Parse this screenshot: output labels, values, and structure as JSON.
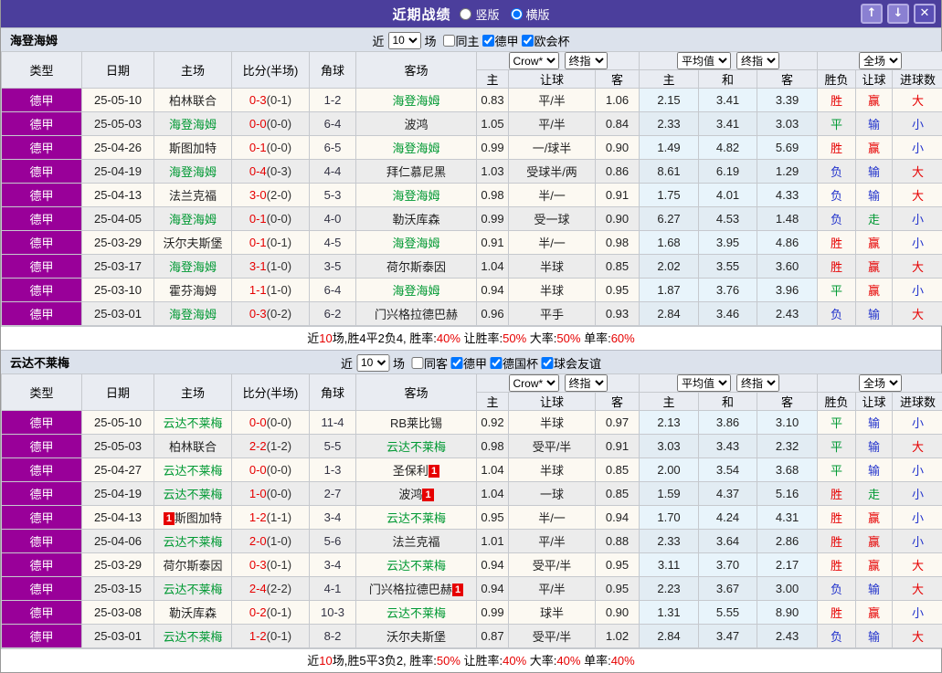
{
  "titlebar": {
    "title": "近期战绩",
    "view_options": [
      {
        "label": "竖版",
        "selected": false
      },
      {
        "label": "横版",
        "selected": true
      }
    ],
    "buttons": {
      "up_glyph": "↑",
      "down_glyph": "↓",
      "close_glyph": "✕"
    }
  },
  "table_header": {
    "cols": {
      "type": "类型",
      "date": "日期",
      "home": "主场",
      "score": "比分(半场)",
      "corner": "角球",
      "away": "客场"
    },
    "selects": {
      "bookmaker": "Crow*",
      "final1": "终指",
      "average": "平均值",
      "final2": "终指",
      "scope": "全场"
    },
    "sub": {
      "odds_home": "主",
      "odds_handicap": "让球",
      "odds_away": "客",
      "avg_home": "主",
      "avg_draw": "和",
      "avg_away": "客",
      "res_outcome": "胜负",
      "res_handicap": "让球",
      "res_goals": "进球数"
    }
  },
  "result_colors": {
    "胜": "red",
    "平": "green",
    "负": "blue",
    "赢": "red",
    "输": "blue",
    "走": "green",
    "大": "red",
    "小": "blue"
  },
  "colors": {
    "accent_purple": "#4b3e9c",
    "league_magenta": "#990099",
    "team_green": "#009933",
    "loss_blue": "#2233cc",
    "win_red": "#e60000"
  },
  "sections": [
    {
      "name": "海登海姆",
      "recent_prefix": "近",
      "games": "10",
      "recent_suffix": "场",
      "filters": [
        {
          "label": "同主",
          "checked": false
        },
        {
          "label": "德甲",
          "checked": true
        },
        {
          "label": "欧会杯",
          "checked": true
        }
      ],
      "rows": [
        {
          "league": "德甲",
          "date": "25-05-10",
          "home": {
            "name": "柏林联合"
          },
          "score": "0-3",
          "half": "(0-1)",
          "corner": "1-2",
          "away": {
            "name": "海登海姆",
            "team": true
          },
          "odds": [
            "0.83",
            "平/半",
            "1.06"
          ],
          "avg": [
            "2.15",
            "3.41",
            "3.39"
          ],
          "res": [
            "胜",
            "赢",
            "大"
          ]
        },
        {
          "league": "德甲",
          "date": "25-05-03",
          "home": {
            "name": "海登海姆",
            "team": true
          },
          "score": "0-0",
          "half": "(0-0)",
          "corner": "6-4",
          "away": {
            "name": "波鸿"
          },
          "odds": [
            "1.05",
            "平/半",
            "0.84"
          ],
          "avg": [
            "2.33",
            "3.41",
            "3.03"
          ],
          "res": [
            "平",
            "输",
            "小"
          ]
        },
        {
          "league": "德甲",
          "date": "25-04-26",
          "home": {
            "name": "斯图加特"
          },
          "score": "0-1",
          "half": "(0-0)",
          "corner": "6-5",
          "away": {
            "name": "海登海姆",
            "team": true
          },
          "odds": [
            "0.99",
            "一/球半",
            "0.90"
          ],
          "avg": [
            "1.49",
            "4.82",
            "5.69"
          ],
          "res": [
            "胜",
            "赢",
            "小"
          ]
        },
        {
          "league": "德甲",
          "date": "25-04-19",
          "home": {
            "name": "海登海姆",
            "team": true
          },
          "score": "0-4",
          "half": "(0-3)",
          "corner": "4-4",
          "away": {
            "name": "拜仁慕尼黑"
          },
          "odds": [
            "1.03",
            "受球半/两",
            "0.86"
          ],
          "avg": [
            "8.61",
            "6.19",
            "1.29"
          ],
          "res": [
            "负",
            "输",
            "大"
          ]
        },
        {
          "league": "德甲",
          "date": "25-04-13",
          "home": {
            "name": "法兰克福"
          },
          "score": "3-0",
          "half": "(2-0)",
          "corner": "5-3",
          "away": {
            "name": "海登海姆",
            "team": true
          },
          "odds": [
            "0.98",
            "半/一",
            "0.91"
          ],
          "avg": [
            "1.75",
            "4.01",
            "4.33"
          ],
          "res": [
            "负",
            "输",
            "大"
          ]
        },
        {
          "league": "德甲",
          "date": "25-04-05",
          "home": {
            "name": "海登海姆",
            "team": true
          },
          "score": "0-1",
          "half": "(0-0)",
          "corner": "4-0",
          "away": {
            "name": "勒沃库森"
          },
          "odds": [
            "0.99",
            "受一球",
            "0.90"
          ],
          "avg": [
            "6.27",
            "4.53",
            "1.48"
          ],
          "res": [
            "负",
            "走",
            "小"
          ]
        },
        {
          "league": "德甲",
          "date": "25-03-29",
          "home": {
            "name": "沃尔夫斯堡"
          },
          "score": "0-1",
          "half": "(0-1)",
          "corner": "4-5",
          "away": {
            "name": "海登海姆",
            "team": true
          },
          "odds": [
            "0.91",
            "半/一",
            "0.98"
          ],
          "avg": [
            "1.68",
            "3.95",
            "4.86"
          ],
          "res": [
            "胜",
            "赢",
            "小"
          ]
        },
        {
          "league": "德甲",
          "date": "25-03-17",
          "home": {
            "name": "海登海姆",
            "team": true
          },
          "score": "3-1",
          "half": "(1-0)",
          "corner": "3-5",
          "away": {
            "name": "荷尔斯泰因"
          },
          "odds": [
            "1.04",
            "半球",
            "0.85"
          ],
          "avg": [
            "2.02",
            "3.55",
            "3.60"
          ],
          "res": [
            "胜",
            "赢",
            "大"
          ]
        },
        {
          "league": "德甲",
          "date": "25-03-10",
          "home": {
            "name": "霍芬海姆"
          },
          "score": "1-1",
          "half": "(1-0)",
          "corner": "6-4",
          "away": {
            "name": "海登海姆",
            "team": true
          },
          "odds": [
            "0.94",
            "半球",
            "0.95"
          ],
          "avg": [
            "1.87",
            "3.76",
            "3.96"
          ],
          "res": [
            "平",
            "赢",
            "小"
          ]
        },
        {
          "league": "德甲",
          "date": "25-03-01",
          "home": {
            "name": "海登海姆",
            "team": true
          },
          "score": "0-3",
          "half": "(0-2)",
          "corner": "6-2",
          "away": {
            "name": "门兴格拉德巴赫"
          },
          "odds": [
            "0.96",
            "平手",
            "0.93"
          ],
          "avg": [
            "2.84",
            "3.46",
            "2.43"
          ],
          "res": [
            "负",
            "输",
            "大"
          ]
        }
      ],
      "summary": [
        {
          "t": "近"
        },
        {
          "t": "10",
          "red": true
        },
        {
          "t": "场,胜4平2负4, 胜率:"
        },
        {
          "t": "40%",
          "red": true
        },
        {
          "t": " 让胜率:"
        },
        {
          "t": "50%",
          "red": true
        },
        {
          "t": " 大率:"
        },
        {
          "t": "50%",
          "red": true
        },
        {
          "t": " 单率:"
        },
        {
          "t": "60%",
          "red": true
        }
      ]
    },
    {
      "name": "云达不莱梅",
      "recent_prefix": "近",
      "games": "10",
      "recent_suffix": "场",
      "filters": [
        {
          "label": "同客",
          "checked": false
        },
        {
          "label": "德甲",
          "checked": true
        },
        {
          "label": "德国杯",
          "checked": true
        },
        {
          "label": "球会友谊",
          "checked": true
        }
      ],
      "rows": [
        {
          "league": "德甲",
          "date": "25-05-10",
          "home": {
            "name": "云达不莱梅",
            "team": true
          },
          "score": "0-0",
          "half": "(0-0)",
          "corner": "11-4",
          "away": {
            "name": "RB莱比锡"
          },
          "odds": [
            "0.92",
            "半球",
            "0.97"
          ],
          "avg": [
            "2.13",
            "3.86",
            "3.10"
          ],
          "res": [
            "平",
            "输",
            "小"
          ]
        },
        {
          "league": "德甲",
          "date": "25-05-03",
          "home": {
            "name": "柏林联合"
          },
          "score": "2-2",
          "half": "(1-2)",
          "corner": "5-5",
          "away": {
            "name": "云达不莱梅",
            "team": true
          },
          "odds": [
            "0.98",
            "受平/半",
            "0.91"
          ],
          "avg": [
            "3.03",
            "3.43",
            "2.32"
          ],
          "res": [
            "平",
            "输",
            "大"
          ]
        },
        {
          "league": "德甲",
          "date": "25-04-27",
          "home": {
            "name": "云达不莱梅",
            "team": true
          },
          "score": "0-0",
          "half": "(0-0)",
          "corner": "1-3",
          "away": {
            "name": "圣保利",
            "badge_after": "1"
          },
          "odds": [
            "1.04",
            "半球",
            "0.85"
          ],
          "avg": [
            "2.00",
            "3.54",
            "3.68"
          ],
          "res": [
            "平",
            "输",
            "小"
          ]
        },
        {
          "league": "德甲",
          "date": "25-04-19",
          "home": {
            "name": "云达不莱梅",
            "team": true
          },
          "score": "1-0",
          "half": "(0-0)",
          "corner": "2-7",
          "away": {
            "name": "波鸿",
            "badge_after": "1"
          },
          "odds": [
            "1.04",
            "一球",
            "0.85"
          ],
          "avg": [
            "1.59",
            "4.37",
            "5.16"
          ],
          "res": [
            "胜",
            "走",
            "小"
          ]
        },
        {
          "league": "德甲",
          "date": "25-04-13",
          "home": {
            "name": "斯图加特",
            "badge_before": "1"
          },
          "score": "1-2",
          "half": "(1-1)",
          "corner": "3-4",
          "away": {
            "name": "云达不莱梅",
            "team": true
          },
          "odds": [
            "0.95",
            "半/一",
            "0.94"
          ],
          "avg": [
            "1.70",
            "4.24",
            "4.31"
          ],
          "res": [
            "胜",
            "赢",
            "小"
          ]
        },
        {
          "league": "德甲",
          "date": "25-04-06",
          "home": {
            "name": "云达不莱梅",
            "team": true
          },
          "score": "2-0",
          "half": "(1-0)",
          "corner": "5-6",
          "away": {
            "name": "法兰克福"
          },
          "odds": [
            "1.01",
            "平/半",
            "0.88"
          ],
          "avg": [
            "2.33",
            "3.64",
            "2.86"
          ],
          "res": [
            "胜",
            "赢",
            "小"
          ]
        },
        {
          "league": "德甲",
          "date": "25-03-29",
          "home": {
            "name": "荷尔斯泰因"
          },
          "score": "0-3",
          "half": "(0-1)",
          "corner": "3-4",
          "away": {
            "name": "云达不莱梅",
            "team": true
          },
          "odds": [
            "0.94",
            "受平/半",
            "0.95"
          ],
          "avg": [
            "3.11",
            "3.70",
            "2.17"
          ],
          "res": [
            "胜",
            "赢",
            "大"
          ]
        },
        {
          "league": "德甲",
          "date": "25-03-15",
          "home": {
            "name": "云达不莱梅",
            "team": true
          },
          "score": "2-4",
          "half": "(2-2)",
          "corner": "4-1",
          "away": {
            "name": "门兴格拉德巴赫",
            "badge_after": "1"
          },
          "odds": [
            "0.94",
            "平/半",
            "0.95"
          ],
          "avg": [
            "2.23",
            "3.67",
            "3.00"
          ],
          "res": [
            "负",
            "输",
            "大"
          ]
        },
        {
          "league": "德甲",
          "date": "25-03-08",
          "home": {
            "name": "勒沃库森"
          },
          "score": "0-2",
          "half": "(0-1)",
          "corner": "10-3",
          "away": {
            "name": "云达不莱梅",
            "team": true
          },
          "odds": [
            "0.99",
            "球半",
            "0.90"
          ],
          "avg": [
            "1.31",
            "5.55",
            "8.90"
          ],
          "res": [
            "胜",
            "赢",
            "小"
          ]
        },
        {
          "league": "德甲",
          "date": "25-03-01",
          "home": {
            "name": "云达不莱梅",
            "team": true
          },
          "score": "1-2",
          "half": "(0-1)",
          "corner": "8-2",
          "away": {
            "name": "沃尔夫斯堡"
          },
          "odds": [
            "0.87",
            "受平/半",
            "1.02"
          ],
          "avg": [
            "2.84",
            "3.47",
            "2.43"
          ],
          "res": [
            "负",
            "输",
            "大"
          ]
        }
      ],
      "summary": [
        {
          "t": "近"
        },
        {
          "t": "10",
          "red": true
        },
        {
          "t": "场,胜5平3负2, 胜率:"
        },
        {
          "t": "50%",
          "red": true
        },
        {
          "t": " 让胜率:"
        },
        {
          "t": "40%",
          "red": true
        },
        {
          "t": " 大率:"
        },
        {
          "t": "40%",
          "red": true
        },
        {
          "t": " 单率:"
        },
        {
          "t": "40%",
          "red": true
        }
      ]
    }
  ]
}
